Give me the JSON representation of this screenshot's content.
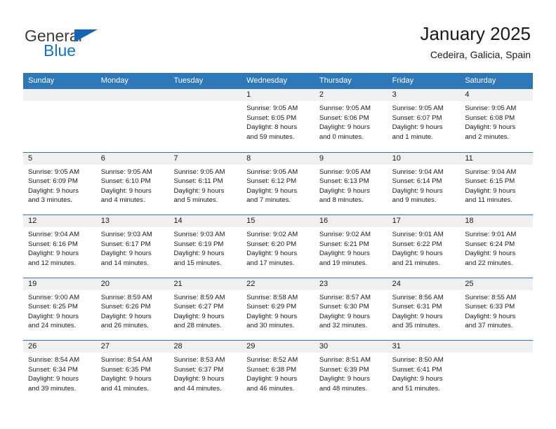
{
  "brand": {
    "name_part1": "General",
    "name_part2": "Blue",
    "accent_color": "#1272c4"
  },
  "header": {
    "title": "January 2025",
    "subtitle": "Cedeira, Galicia, Spain",
    "header_bg_color": "#2e77b8"
  },
  "weekdays": [
    "Sunday",
    "Monday",
    "Tuesday",
    "Wednesday",
    "Thursday",
    "Friday",
    "Saturday"
  ],
  "weeks": [
    [
      {
        "day": "",
        "lines": []
      },
      {
        "day": "",
        "lines": []
      },
      {
        "day": "",
        "lines": []
      },
      {
        "day": "1",
        "lines": [
          "Sunrise: 9:05 AM",
          "Sunset: 6:05 PM",
          "Daylight: 8 hours",
          "and 59 minutes."
        ]
      },
      {
        "day": "2",
        "lines": [
          "Sunrise: 9:05 AM",
          "Sunset: 6:06 PM",
          "Daylight: 9 hours",
          "and 0 minutes."
        ]
      },
      {
        "day": "3",
        "lines": [
          "Sunrise: 9:05 AM",
          "Sunset: 6:07 PM",
          "Daylight: 9 hours",
          "and 1 minute."
        ]
      },
      {
        "day": "4",
        "lines": [
          "Sunrise: 9:05 AM",
          "Sunset: 6:08 PM",
          "Daylight: 9 hours",
          "and 2 minutes."
        ]
      }
    ],
    [
      {
        "day": "5",
        "lines": [
          "Sunrise: 9:05 AM",
          "Sunset: 6:09 PM",
          "Daylight: 9 hours",
          "and 3 minutes."
        ]
      },
      {
        "day": "6",
        "lines": [
          "Sunrise: 9:05 AM",
          "Sunset: 6:10 PM",
          "Daylight: 9 hours",
          "and 4 minutes."
        ]
      },
      {
        "day": "7",
        "lines": [
          "Sunrise: 9:05 AM",
          "Sunset: 6:11 PM",
          "Daylight: 9 hours",
          "and 5 minutes."
        ]
      },
      {
        "day": "8",
        "lines": [
          "Sunrise: 9:05 AM",
          "Sunset: 6:12 PM",
          "Daylight: 9 hours",
          "and 7 minutes."
        ]
      },
      {
        "day": "9",
        "lines": [
          "Sunrise: 9:05 AM",
          "Sunset: 6:13 PM",
          "Daylight: 9 hours",
          "and 8 minutes."
        ]
      },
      {
        "day": "10",
        "lines": [
          "Sunrise: 9:04 AM",
          "Sunset: 6:14 PM",
          "Daylight: 9 hours",
          "and 9 minutes."
        ]
      },
      {
        "day": "11",
        "lines": [
          "Sunrise: 9:04 AM",
          "Sunset: 6:15 PM",
          "Daylight: 9 hours",
          "and 11 minutes."
        ]
      }
    ],
    [
      {
        "day": "12",
        "lines": [
          "Sunrise: 9:04 AM",
          "Sunset: 6:16 PM",
          "Daylight: 9 hours",
          "and 12 minutes."
        ]
      },
      {
        "day": "13",
        "lines": [
          "Sunrise: 9:03 AM",
          "Sunset: 6:17 PM",
          "Daylight: 9 hours",
          "and 14 minutes."
        ]
      },
      {
        "day": "14",
        "lines": [
          "Sunrise: 9:03 AM",
          "Sunset: 6:19 PM",
          "Daylight: 9 hours",
          "and 15 minutes."
        ]
      },
      {
        "day": "15",
        "lines": [
          "Sunrise: 9:02 AM",
          "Sunset: 6:20 PM",
          "Daylight: 9 hours",
          "and 17 minutes."
        ]
      },
      {
        "day": "16",
        "lines": [
          "Sunrise: 9:02 AM",
          "Sunset: 6:21 PM",
          "Daylight: 9 hours",
          "and 19 minutes."
        ]
      },
      {
        "day": "17",
        "lines": [
          "Sunrise: 9:01 AM",
          "Sunset: 6:22 PM",
          "Daylight: 9 hours",
          "and 21 minutes."
        ]
      },
      {
        "day": "18",
        "lines": [
          "Sunrise: 9:01 AM",
          "Sunset: 6:24 PM",
          "Daylight: 9 hours",
          "and 22 minutes."
        ]
      }
    ],
    [
      {
        "day": "19",
        "lines": [
          "Sunrise: 9:00 AM",
          "Sunset: 6:25 PM",
          "Daylight: 9 hours",
          "and 24 minutes."
        ]
      },
      {
        "day": "20",
        "lines": [
          "Sunrise: 8:59 AM",
          "Sunset: 6:26 PM",
          "Daylight: 9 hours",
          "and 26 minutes."
        ]
      },
      {
        "day": "21",
        "lines": [
          "Sunrise: 8:59 AM",
          "Sunset: 6:27 PM",
          "Daylight: 9 hours",
          "and 28 minutes."
        ]
      },
      {
        "day": "22",
        "lines": [
          "Sunrise: 8:58 AM",
          "Sunset: 6:29 PM",
          "Daylight: 9 hours",
          "and 30 minutes."
        ]
      },
      {
        "day": "23",
        "lines": [
          "Sunrise: 8:57 AM",
          "Sunset: 6:30 PM",
          "Daylight: 9 hours",
          "and 32 minutes."
        ]
      },
      {
        "day": "24",
        "lines": [
          "Sunrise: 8:56 AM",
          "Sunset: 6:31 PM",
          "Daylight: 9 hours",
          "and 35 minutes."
        ]
      },
      {
        "day": "25",
        "lines": [
          "Sunrise: 8:55 AM",
          "Sunset: 6:33 PM",
          "Daylight: 9 hours",
          "and 37 minutes."
        ]
      }
    ],
    [
      {
        "day": "26",
        "lines": [
          "Sunrise: 8:54 AM",
          "Sunset: 6:34 PM",
          "Daylight: 9 hours",
          "and 39 minutes."
        ]
      },
      {
        "day": "27",
        "lines": [
          "Sunrise: 8:54 AM",
          "Sunset: 6:35 PM",
          "Daylight: 9 hours",
          "and 41 minutes."
        ]
      },
      {
        "day": "28",
        "lines": [
          "Sunrise: 8:53 AM",
          "Sunset: 6:37 PM",
          "Daylight: 9 hours",
          "and 44 minutes."
        ]
      },
      {
        "day": "29",
        "lines": [
          "Sunrise: 8:52 AM",
          "Sunset: 6:38 PM",
          "Daylight: 9 hours",
          "and 46 minutes."
        ]
      },
      {
        "day": "30",
        "lines": [
          "Sunrise: 8:51 AM",
          "Sunset: 6:39 PM",
          "Daylight: 9 hours",
          "and 48 minutes."
        ]
      },
      {
        "day": "31",
        "lines": [
          "Sunrise: 8:50 AM",
          "Sunset: 6:41 PM",
          "Daylight: 9 hours",
          "and 51 minutes."
        ]
      },
      {
        "day": "",
        "lines": []
      }
    ]
  ]
}
